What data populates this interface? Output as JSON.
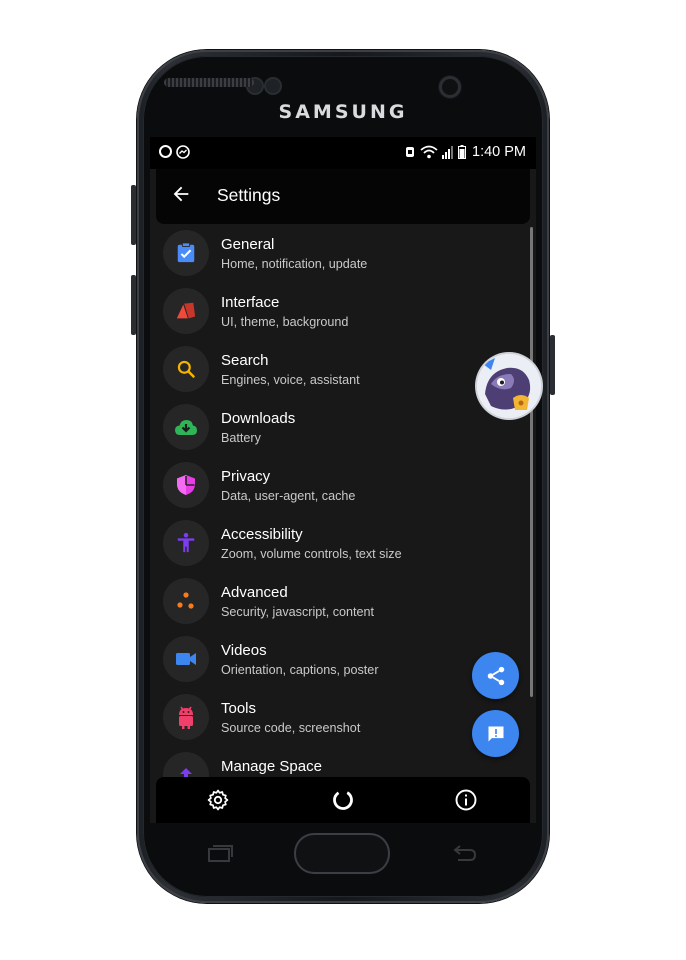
{
  "device": {
    "brand": "SAMSUNG"
  },
  "status_bar": {
    "time": "1:40 PM"
  },
  "app_bar": {
    "title": "Settings"
  },
  "settings_items": [
    {
      "label": "General",
      "subtitle": "Home, notification, update",
      "icon": "clipboard-check-icon",
      "color": "#4b8df8"
    },
    {
      "label": "Interface",
      "subtitle": "UI, theme, background",
      "icon": "interface-shapes-icon",
      "color": "#ef4a3a"
    },
    {
      "label": "Search",
      "subtitle": "Engines, voice, assistant",
      "icon": "search-icon",
      "color": "#f4b400"
    },
    {
      "label": "Downloads",
      "subtitle": "Battery",
      "icon": "cloud-download-icon",
      "color": "#2fb457"
    },
    {
      "label": "Privacy",
      "subtitle": "Data, user-agent, cache",
      "icon": "shield-icon",
      "color": "#e83ce6"
    },
    {
      "label": "Accessibility",
      "subtitle": "Zoom, volume controls, text size",
      "icon": "accessibility-icon",
      "color": "#7c3cf0"
    },
    {
      "label": "Advanced",
      "subtitle": "Security, javascript, content",
      "icon": "dots-icon",
      "color": "#f57c1f"
    },
    {
      "label": "Videos",
      "subtitle": "Orientation, captions, poster",
      "icon": "videocam-icon",
      "color": "#3d86f0"
    },
    {
      "label": "Tools",
      "subtitle": "Source code, screenshot",
      "icon": "android-icon",
      "color": "#ef3f6a"
    },
    {
      "label": "Manage Space",
      "subtitle": "",
      "icon": "manage-space-icon",
      "color": "#7c3cf0"
    }
  ],
  "fab": {
    "share_icon": "share-icon",
    "feedback_icon": "feedback-icon",
    "color": "#3d86f0"
  },
  "bottom_bar": {
    "left_icon": "gear-icon",
    "center_icon": "loading-ring-icon",
    "right_icon": "info-icon"
  }
}
